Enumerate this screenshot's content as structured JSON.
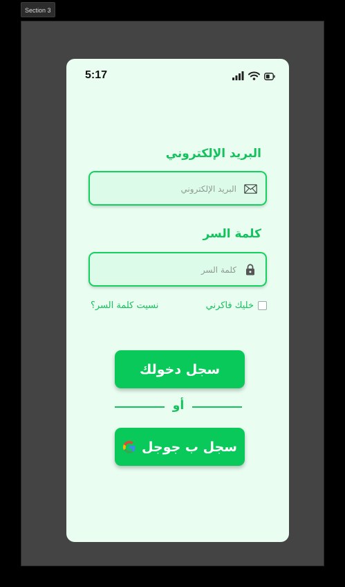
{
  "canvas": {
    "section_label": "Section 3"
  },
  "status_bar": {
    "time": "5:17"
  },
  "form": {
    "email_label": "البريد الإلكتروني",
    "email_placeholder": "البريد الإلكتروني",
    "email_value": "",
    "password_label": "كلمة السر",
    "password_placeholder": "كلمة السر",
    "password_value": "",
    "remember_label": "خليك فاكرني",
    "remember_checked": false,
    "forgot_label": "نسيت كلمة السر؟"
  },
  "actions": {
    "login_label": "سجل دخولك",
    "or_label": "أو",
    "google_label": "سجل ب جوجل"
  },
  "colors": {
    "accent": "#13c25c",
    "button": "#0ac95b",
    "screen_bg": "#e9fdf1",
    "field_bg": "#dcfbe8"
  },
  "icons": {
    "email": "mail-icon",
    "password": "lock-icon",
    "google": "google-icon",
    "signal": "signal-icon",
    "wifi": "wifi-icon",
    "battery": "battery-icon"
  }
}
